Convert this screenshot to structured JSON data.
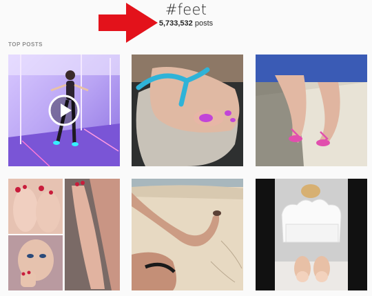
{
  "header": {
    "hashtag": "#feet",
    "post_count": "5,733,532",
    "post_count_unit": "posts"
  },
  "annotation": {
    "arrow_color": "#e3121b"
  },
  "sections": {
    "top_posts_label": "TOP POSTS"
  },
  "posts": [
    {
      "kind": "video",
      "icon": "play-icon"
    },
    {
      "kind": "photo"
    },
    {
      "kind": "photo"
    },
    {
      "kind": "photo"
    },
    {
      "kind": "photo"
    },
    {
      "kind": "photo"
    }
  ],
  "colors": {
    "background": "#fafafa",
    "text": "#262626",
    "secondary_text": "#8e8e8e"
  }
}
